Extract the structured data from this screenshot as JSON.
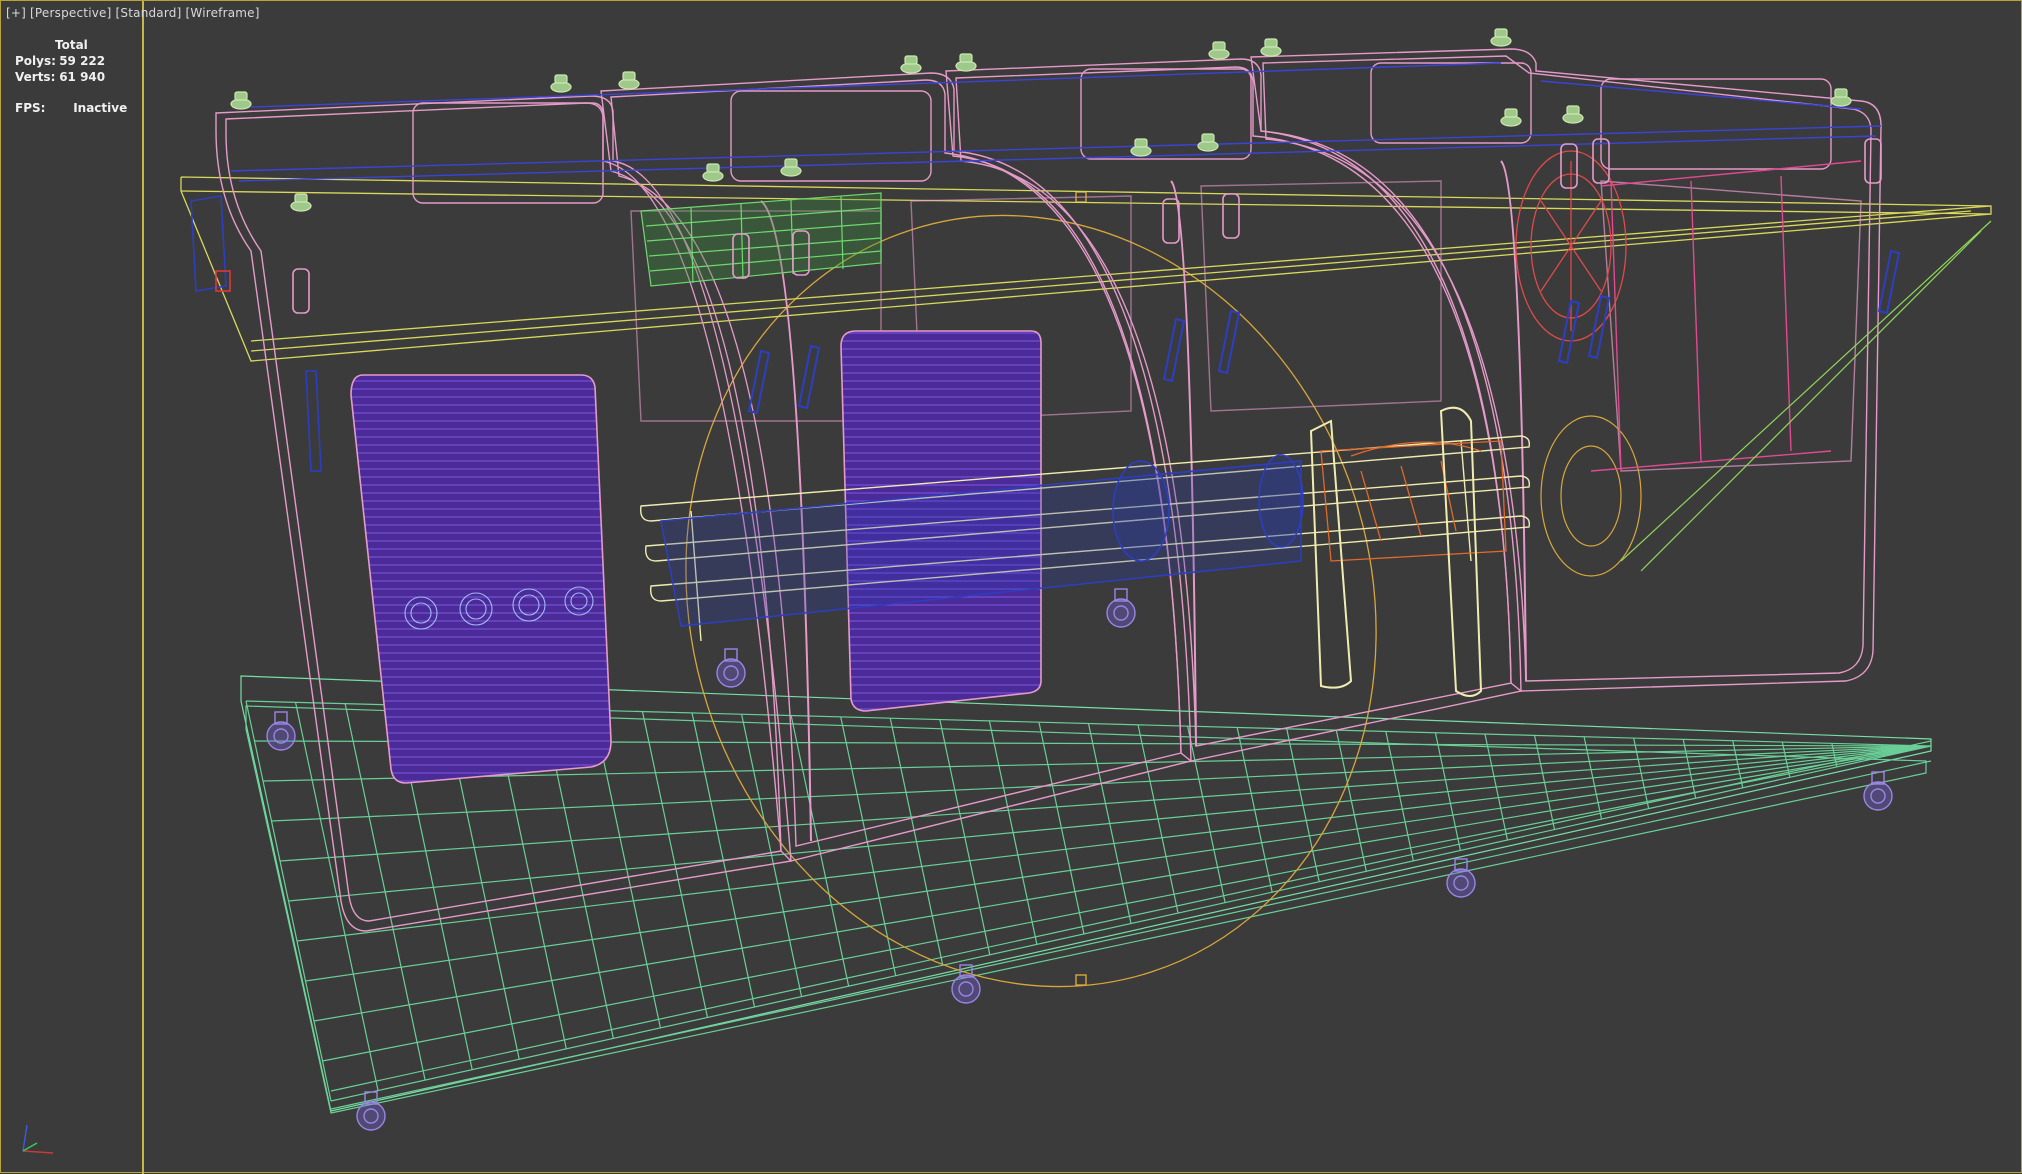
{
  "viewport": {
    "label_plus": "[+]",
    "label_view": "[Perspective]",
    "label_shading": "[Standard]",
    "label_mode": "[Wireframe]"
  },
  "stats": {
    "header": "Total",
    "polys_label": "Polys:",
    "polys_value": "59 222",
    "verts_label": "Verts:",
    "verts_value": "61 940",
    "fps_label": "FPS:",
    "fps_value": "Inactive"
  },
  "colors": {
    "background": "#3b3b3b",
    "shell_wire": "#e59bc9",
    "frame_wire": "#b47bd8",
    "base_wire": "#6fe0a0",
    "accent_yellow": "#d8d85a",
    "panel_fill": "#4b2d9a",
    "trajectory": "#d8a73a",
    "blue_parts": "#2c3fc2",
    "orange_parts": "#e06a2a",
    "caster": "#9b84e8",
    "bolt": "#cde8b0"
  },
  "icons": {
    "axis": "xyz-axis-icon"
  }
}
